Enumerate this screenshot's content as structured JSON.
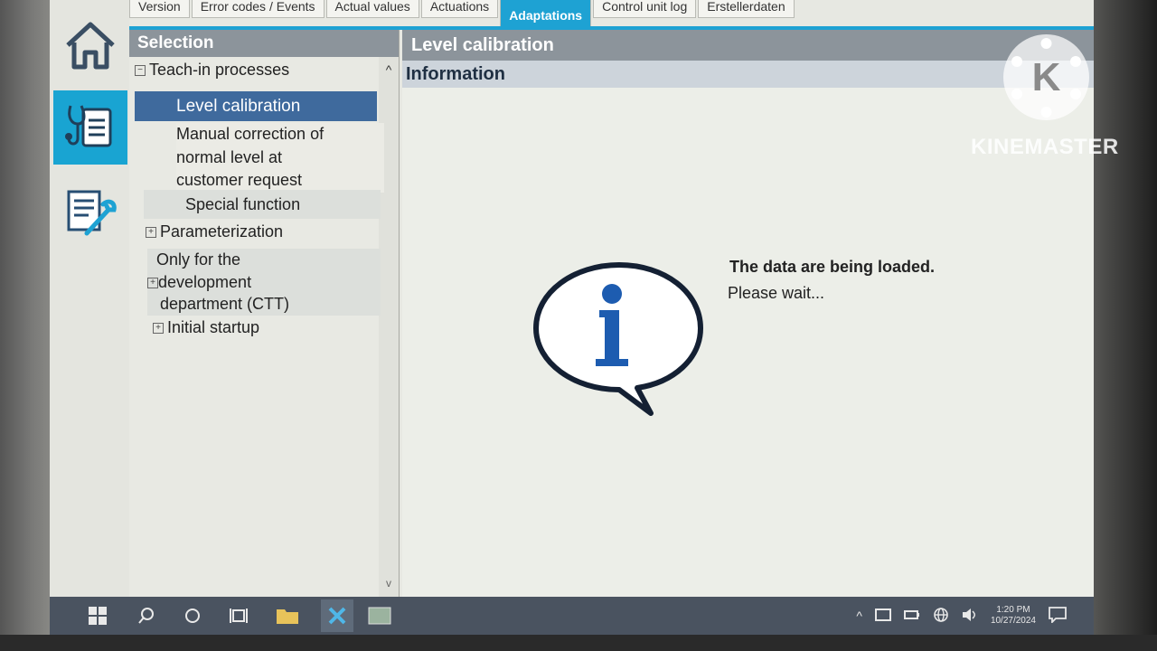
{
  "tabs": [
    {
      "label": "Version"
    },
    {
      "label": "Error codes / Events"
    },
    {
      "label": "Actual values"
    },
    {
      "label": "Actuations"
    },
    {
      "label": "Adaptations",
      "active": true
    },
    {
      "label": "Control unit log"
    },
    {
      "label": "Erstellerdaten"
    }
  ],
  "selection": {
    "title": "Selection",
    "teach_in": "Teach-in processes",
    "level_calibration": "Level calibration",
    "manual_correction": [
      "Manual correction of",
      "normal level at",
      "customer request"
    ],
    "special_function": "Special function",
    "parameterization": "Parameterization",
    "development": [
      "Only for the",
      "development",
      "department (CTT)"
    ],
    "initial_startup": "Initial startup",
    "expanded_symbol": "−",
    "collapsed_symbol": "+"
  },
  "main": {
    "title": "Level calibration",
    "info_label": "Information",
    "message_title": "The data are being loaded.",
    "message_sub": "Please wait..."
  },
  "taskbar": {
    "time": "1:20 PM",
    "date": "10/27/2024"
  },
  "watermark": {
    "letter": "K",
    "text": "KINEMASTER"
  },
  "colors": {
    "accent": "#1ea2d3",
    "selected_row": "#3f6a9d",
    "panel_header": "#8c949b",
    "info_bar": "#cdd4db"
  }
}
